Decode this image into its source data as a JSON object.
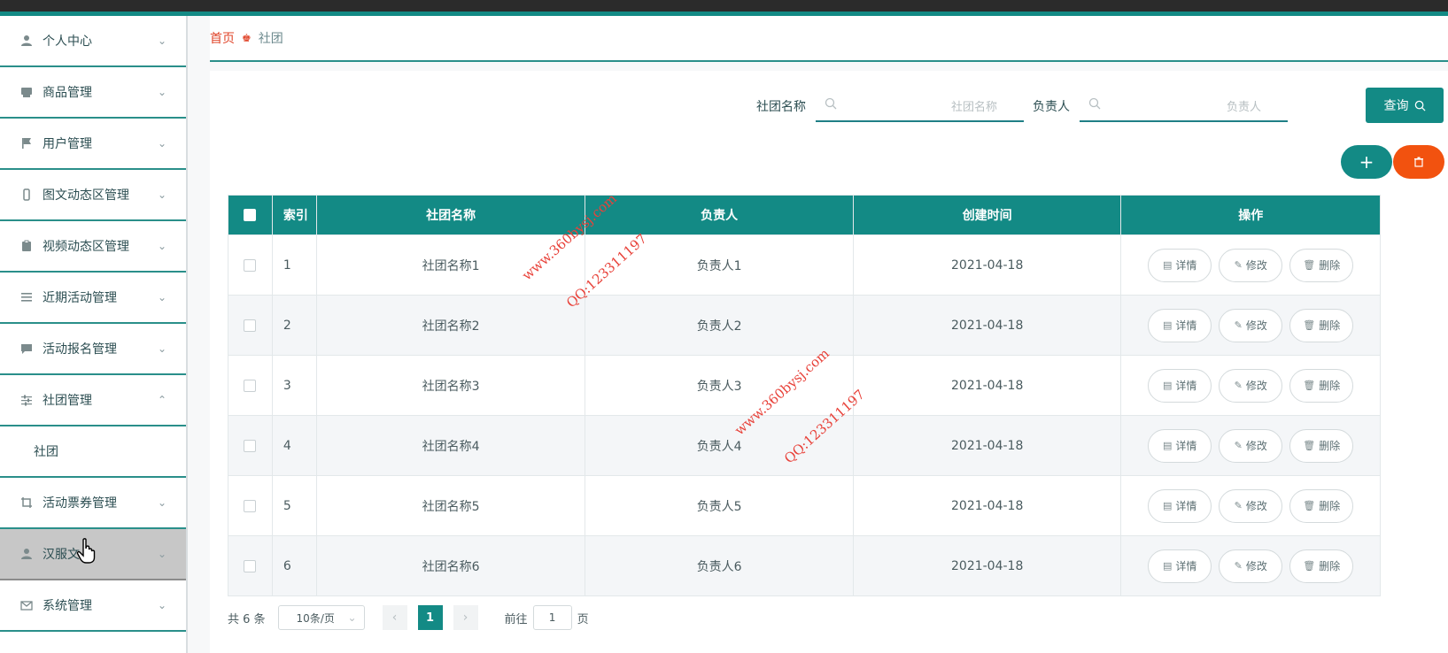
{
  "sidebar": {
    "items": [
      {
        "label": "个人中心",
        "icon": "user-icon"
      },
      {
        "label": "商品管理",
        "icon": "box-icon"
      },
      {
        "label": "用户管理",
        "icon": "flag-icon"
      },
      {
        "label": "图文动态区管理",
        "icon": "phone-icon"
      },
      {
        "label": "视频动态区管理",
        "icon": "clipboard-icon"
      },
      {
        "label": "近期活动管理",
        "icon": "list-icon"
      },
      {
        "label": "活动报名管理",
        "icon": "chat-icon"
      },
      {
        "label": "社团管理",
        "icon": "sliders-icon",
        "expanded": true
      },
      {
        "label": "活动票券管理",
        "icon": "crop-icon"
      },
      {
        "label": "汉服文",
        "icon": "user-icon",
        "hover": true
      },
      {
        "label": "系统管理",
        "icon": "mail-icon"
      }
    ],
    "submenu": {
      "label": "社团"
    }
  },
  "breadcrumb": {
    "home": "首页",
    "current": "社团"
  },
  "search": {
    "name_label": "社团名称",
    "name_placeholder": "社团名称",
    "owner_label": "负责人",
    "owner_placeholder": "负责人",
    "query_label": "查询"
  },
  "table": {
    "headers": {
      "index": "索引",
      "name": "社团名称",
      "owner": "负责人",
      "time": "创建时间",
      "ops": "操作"
    },
    "rows": [
      {
        "index": "1",
        "name": "社团名称1",
        "owner": "负责人1",
        "time": "2021-04-18"
      },
      {
        "index": "2",
        "name": "社团名称2",
        "owner": "负责人2",
        "time": "2021-04-18"
      },
      {
        "index": "3",
        "name": "社团名称3",
        "owner": "负责人3",
        "time": "2021-04-18"
      },
      {
        "index": "4",
        "name": "社团名称4",
        "owner": "负责人4",
        "time": "2021-04-18"
      },
      {
        "index": "5",
        "name": "社团名称5",
        "owner": "负责人5",
        "time": "2021-04-18"
      },
      {
        "index": "6",
        "name": "社团名称6",
        "owner": "负责人6",
        "time": "2021-04-18"
      }
    ],
    "actions": {
      "detail": "详情",
      "edit": "修改",
      "delete": "删除"
    }
  },
  "pager": {
    "total": "共 6 条",
    "size": "10条/页",
    "current": "1",
    "goto": "前往",
    "goto_value": "1",
    "unit": "页"
  },
  "watermark": {
    "site": "www.360bysj.com",
    "qq": "QQ:123311197"
  },
  "colors": {
    "accent": "#138a85",
    "danger": "#f2520f",
    "breadcrumb_home": "#e0452a"
  }
}
